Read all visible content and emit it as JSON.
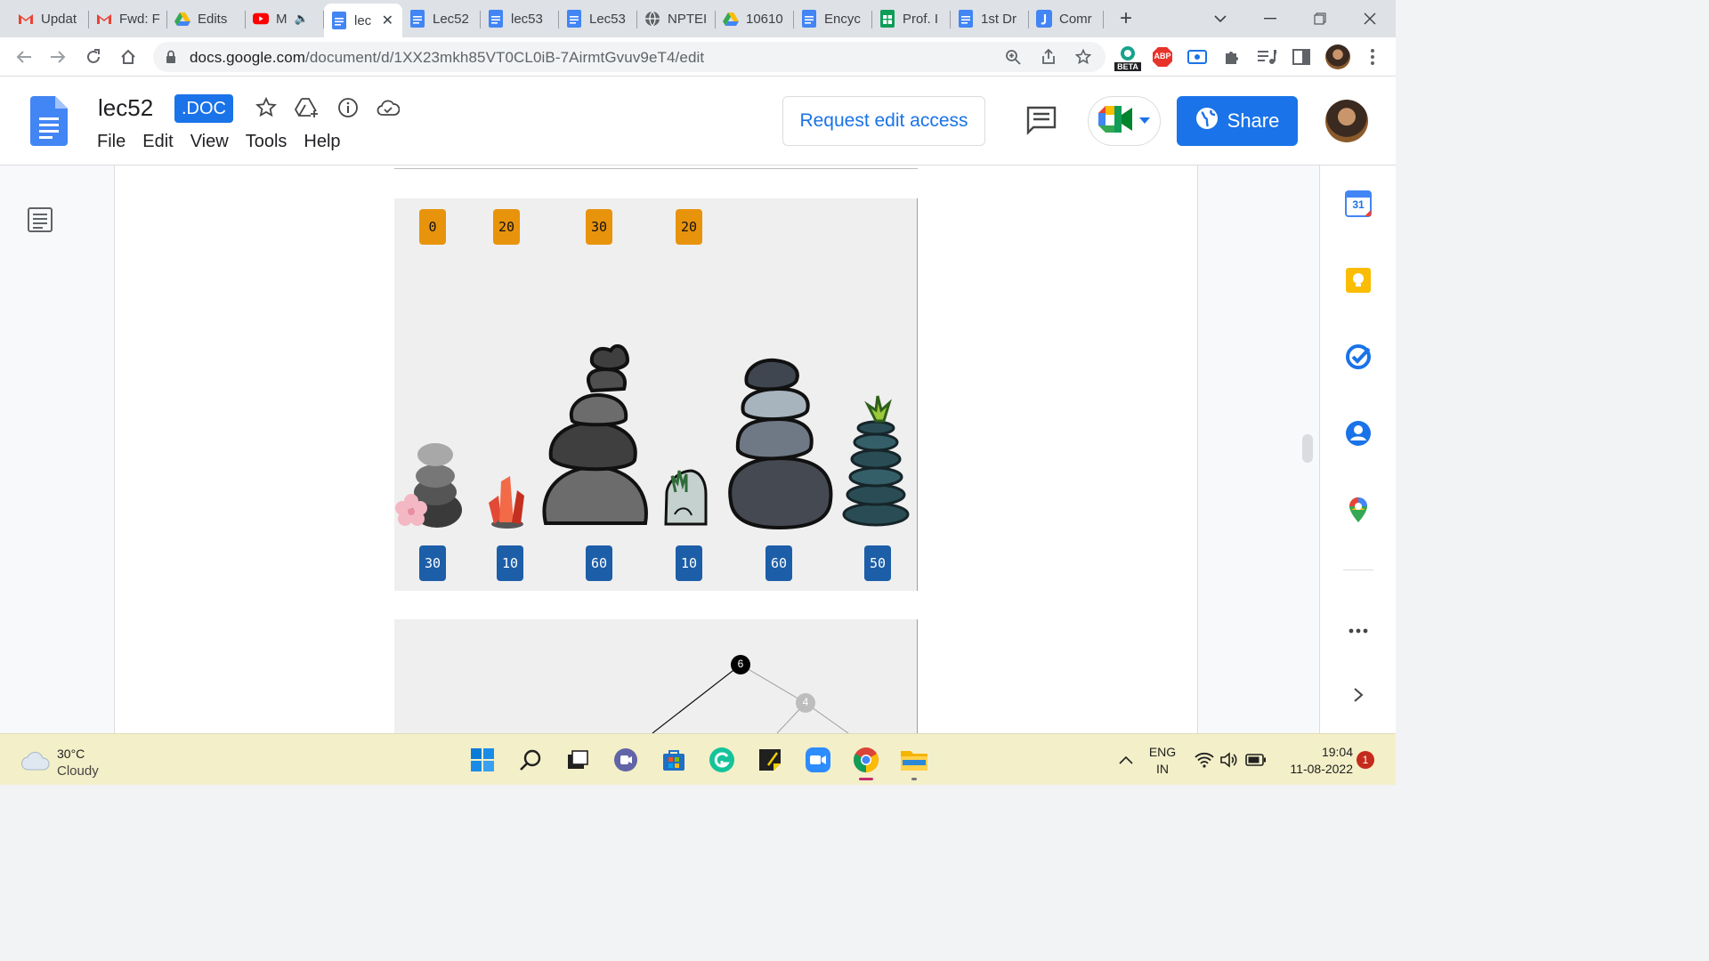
{
  "tabs": [
    {
      "label": "Updat",
      "icon": "gmail-icon"
    },
    {
      "label": "Fwd: F",
      "icon": "gmail-icon"
    },
    {
      "label": "Edits",
      "icon": "drive-icon"
    },
    {
      "label": "M",
      "icon": "youtube-icon"
    },
    {
      "label": "lec",
      "icon": "docs-icon",
      "active": true
    },
    {
      "label": "Lec52",
      "icon": "docs-icon"
    },
    {
      "label": "lec53",
      "icon": "docs-icon"
    },
    {
      "label": "Lec53",
      "icon": "docs-icon"
    },
    {
      "label": "NPTEI",
      "icon": "globe-icon"
    },
    {
      "label": "10610",
      "icon": "drive-icon"
    },
    {
      "label": "Encyc",
      "icon": "docs-icon"
    },
    {
      "label": "Prof. I",
      "icon": "sheets-icon"
    },
    {
      "label": "1st Dr",
      "icon": "docs-icon"
    },
    {
      "label": "Comr",
      "icon": "jamboard-icon"
    }
  ],
  "browser": {
    "url_host": "docs.google.com",
    "url_path": "/document/d/1XX23mkh85VT0CL0iB-7AirmtGvuv9eT4/edit",
    "beta_label": "BETA",
    "abp_label": "ABP"
  },
  "doc": {
    "title": "lec52",
    "badge": ".DOC",
    "menu": [
      "File",
      "Edit",
      "View",
      "Tools",
      "Help"
    ],
    "request_edit": "Request edit access",
    "share": "Share"
  },
  "figure1": {
    "top_values": [
      "0",
      "20",
      "30",
      "20"
    ],
    "bottom_values": [
      "30",
      "10",
      "60",
      "10",
      "60",
      "50"
    ]
  },
  "figure2": {
    "nodes": [
      "6",
      "4"
    ]
  },
  "side_panel": {
    "calendar_day": "31"
  },
  "taskbar": {
    "temperature": "30°C",
    "condition": "Cloudy",
    "lang1": "ENG",
    "lang2": "IN",
    "time": "19:04",
    "date": "11-08-2022",
    "notifications": "1"
  },
  "colors": {
    "accent": "#1a73e8",
    "orange_badge": "#e8930c",
    "blue_badge": "#1d5ea8",
    "taskbar": "#f3efc8"
  }
}
